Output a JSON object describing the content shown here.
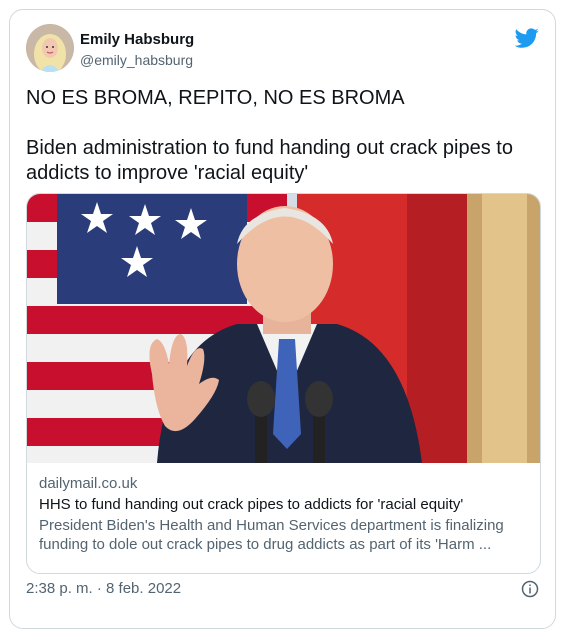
{
  "user": {
    "display_name": "Emily Habsburg",
    "handle": "@emily_habsburg"
  },
  "tweet": {
    "line1": "NO ES BROMA, REPITO, NO ES BROMA",
    "line2": "Biden administration to fund handing out crack pipes to addicts to improve 'racial equity'",
    "timestamp": "2:38 p. m. · 8 feb. 2022"
  },
  "card": {
    "domain": "dailymail.co.uk",
    "title": "HHS to fund handing out crack pipes to addicts for 'racial equity'",
    "description": "President Biden's Health and Human Services department is finalizing funding to dole out crack pipes to drug addicts as part of its 'Harm ..."
  },
  "colors": {
    "twitter_blue": "#1d9bf0",
    "text_primary": "#0f1419",
    "text_secondary": "#536471",
    "border": "#cfd9de"
  },
  "icons": {
    "brand": "twitter-bird-icon",
    "info": "info-icon"
  }
}
